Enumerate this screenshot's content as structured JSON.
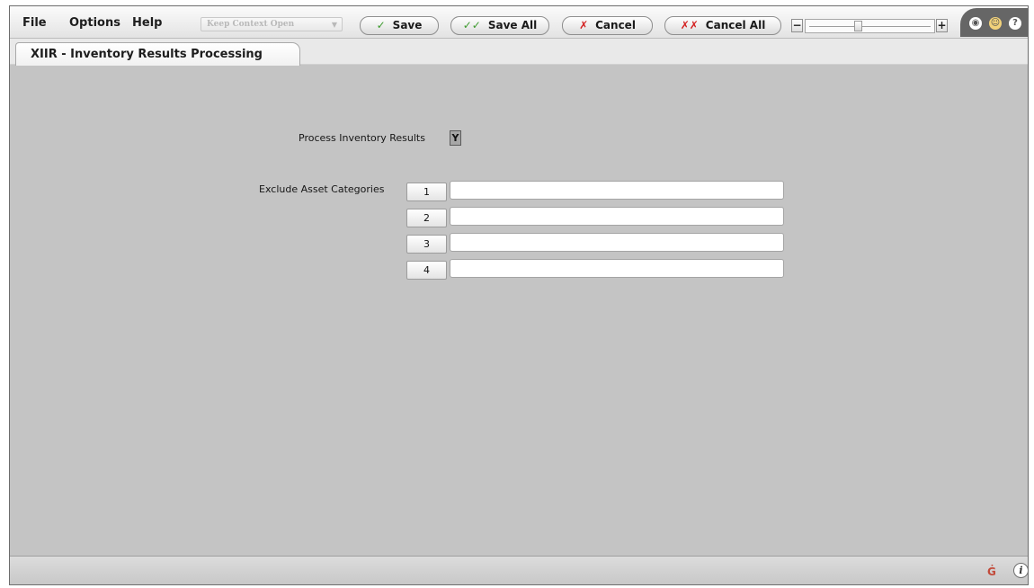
{
  "menu": {
    "file": "File",
    "options": "Options",
    "help": "Help"
  },
  "toolbar": {
    "keep_context_open": "Keep Context Open",
    "save": "Save",
    "save_all": "Save All",
    "cancel": "Cancel",
    "cancel_all": "Cancel All",
    "zoom_minus": "−",
    "zoom_plus": "+",
    "icons": [
      "globe-icon",
      "favorites-icon",
      "help-icon"
    ]
  },
  "tab": {
    "title": "XIIR - Inventory Results Processing"
  },
  "form": {
    "process_label": "Process Inventory Results",
    "process_value": "Y",
    "exclude_label": "Exclude Asset Categories",
    "categories": [
      {
        "number": "1",
        "value": ""
      },
      {
        "number": "2",
        "value": ""
      },
      {
        "number": "3",
        "value": ""
      },
      {
        "number": "4",
        "value": ""
      }
    ]
  },
  "status": {
    "icons": [
      "lock-icon",
      "info-icon"
    ]
  },
  "colors": {
    "workspace": "#c4c4c4",
    "save_check": "#3d9b2e",
    "cancel_x": "#d42020"
  }
}
